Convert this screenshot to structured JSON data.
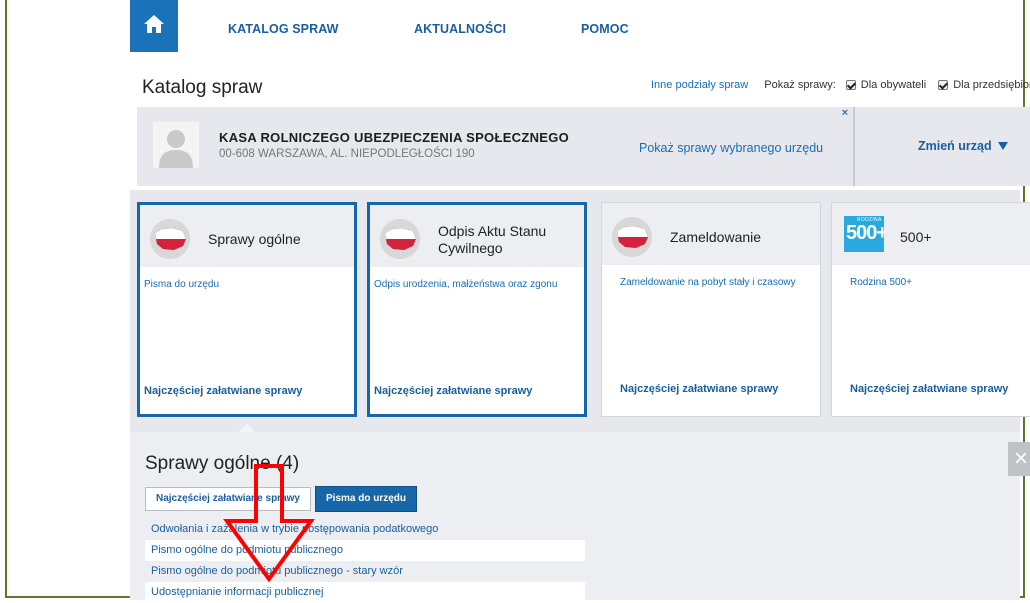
{
  "nav": {
    "items": [
      "KATALOG SPRAW",
      "AKTUALNOŚCI",
      "POMOC"
    ]
  },
  "page": {
    "title": "Katalog spraw"
  },
  "filters": {
    "link": "Inne podziały spraw",
    "label": "Pokaż sprawy:",
    "option1": "Dla obywateli",
    "option2": "Dla przedsiębior"
  },
  "office": {
    "name": "KASA ROLNICZEGO UBEZPIECZENIA SPOŁECZNEGO",
    "address": "00-608 WARSZAWA, AL. NIEPODLEGŁOŚCI 190",
    "show_link": "Pokaż sprawy wybranego urzędu",
    "change_label": "Zmień urząd",
    "close_glyph": "×"
  },
  "cards": [
    {
      "title": "Sprawy ogólne",
      "body": "Pisma do urzędu",
      "footer": "Najczęściej załatwiane sprawy"
    },
    {
      "title": "Odpis Aktu Stanu Cywilnego",
      "body": "Odpis urodzenia, małżeństwa oraz zgonu",
      "footer": "Najczęściej załatwiane sprawy"
    },
    {
      "title": "Zameldowanie",
      "body": "Zameldowanie na pobyt stały i czasowy",
      "footer": "Najczęściej załatwiane sprawy"
    },
    {
      "title": "500+",
      "body": "Rodzina 500+",
      "footer": "Najczęściej załatwiane sprawy",
      "logo_small": "RODZINA",
      "logo_big": "500+"
    }
  ],
  "section": {
    "title": "Sprawy ogólne (4)",
    "close_glyph": "×",
    "tab_frequent": "Najczęściej załatwiane sprawy",
    "tab_letters": "Pisma do urzędu",
    "items": [
      "Odwołania i zażalenia w trybie postępowania podatkowego",
      "Pismo ogólne do podmiotu publicznego",
      "Pismo ogólne do podmiotu publicznego - stary wzór",
      "Udostępnianie informacji publicznej"
    ]
  },
  "colors": {
    "brand_blue": "#1666a8",
    "link_blue": "#1a6db0",
    "panel_gray": "#e6e8ed",
    "annotation_red": "#ff0000"
  }
}
